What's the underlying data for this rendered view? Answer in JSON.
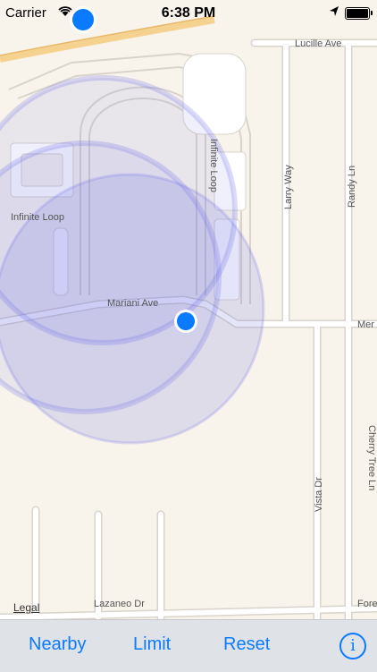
{
  "status_bar": {
    "carrier": "Carrier",
    "time": "6:38 PM"
  },
  "map": {
    "labels": {
      "lucille_ave": "Lucille Ave",
      "infinite_loop_west": "Infinite Loop",
      "infinite_loop_vertical": "Infinite Loop",
      "larry_way": "Larry Way",
      "randy_ln": "Randy Ln",
      "mariani_ave": "Mariani Ave",
      "mer": "Mer",
      "vista_dr": "Vista Dr",
      "cherry_tree_ln": "Cherry Tree Ln",
      "lazaneo_dr": "Lazaneo Dr",
      "fore": "Fore"
    },
    "legal": "Legal"
  },
  "toolbar": {
    "nearby": "Nearby",
    "limit": "Limit",
    "reset": "Reset",
    "info_icon": "info-icon"
  },
  "colors": {
    "accent": "#0a7aff",
    "map_background": "#f8f4ec",
    "toolbar_background": "#dfe2e7"
  }
}
